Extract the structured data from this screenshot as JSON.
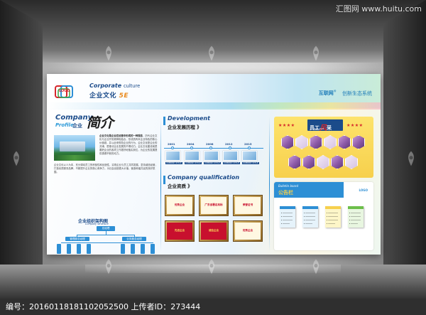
{
  "site": {
    "brand_cn": "汇图网",
    "brand_url": "www.huitu.com"
  },
  "board": {
    "logo_text": "LOGO",
    "corporate_en": "Corporate",
    "corporate_en_small": "culture",
    "corporate_cn": "企业文化",
    "corporate_5e": "5E",
    "header_brand": "互联网",
    "header_brand_mark": "®",
    "header_tagline": "创新生态系统",
    "profile": {
      "title_en_1": "Company",
      "title_en_2": "Profile",
      "title_cn": "企业",
      "title_big": "简介",
      "text_lead": "企业文化是企业在经营中形成的一种观念",
      "text_body": "，历代企业文化与企业开拓精神相结合，形成具有本企业特色的核心价值观，并以此来规范企业的行为，企业文化是企业的灵魂，是推动企业发展的不竭动力。企业文化建设就是要把企业的各项工作更好地落实到位，为企业的发展提供源源不断的动力。",
      "text_more": "企业文化以人为本，充分调动员工的积极性和创造性，实现企业与员工共同发展。坚持诚信经营，打造优质服务品牌，不断提升企业的核心竞争力，为社会创造更大价值，营造和谐共赢的良好氛围。",
      "org_title": "企业组织架构图",
      "org_sub": "Company structure",
      "org_top": "总经理",
      "org_mid_left": "管理副总经理",
      "org_mid_right": "业务副总经理"
    },
    "development": {
      "title_en": "Development",
      "title_cn": "企业发展历程 》",
      "years": [
        "2001",
        "2004",
        "2008",
        "2012",
        "2015"
      ],
      "captions": [
        "COMPANY STYLE",
        "COMPANY STYLE",
        "COMPANY STYLE",
        "COMPANY STYLE",
        "COMPANY STYLE"
      ]
    },
    "qualification": {
      "title_en": "Company qualification",
      "title_cn": "企业资质 》",
      "certs": [
        "优秀企业",
        "广东省著名商标",
        "荣誉证书",
        "先进企业",
        "诚信企业",
        "优秀企业"
      ]
    },
    "staff": {
      "title_cn_1": "员工",
      "title_cn_feng": "风",
      "title_cn_2": "采",
      "title_en": "Staff style",
      "stars": "★★★★"
    },
    "bulletin": {
      "title_en": "Bulletin board",
      "title_cn": "公告栏",
      "logo": "LOGO"
    }
  },
  "footer": {
    "label_id": "编号：",
    "id_value": "20160118181102052500",
    "label_uploader": "上传者ID：",
    "uploader_value": "273444"
  },
  "colors": {
    "brand_blue": "#1b4b8a",
    "accent_blue": "#2d8fd5",
    "staff_yellow": "#f7d04c",
    "accent_red": "#d5262b"
  },
  "icons": [
    "huitu-watermark-icon",
    "logo-rings-icon"
  ]
}
